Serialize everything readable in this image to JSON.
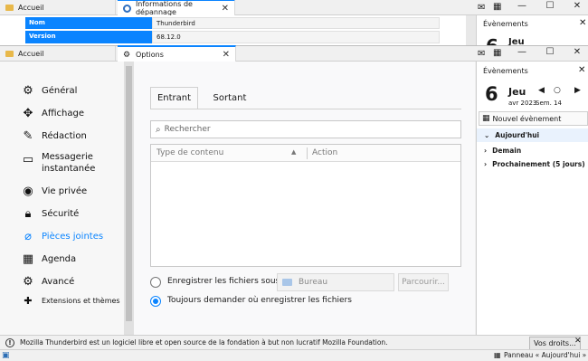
{
  "bg_window": {
    "tabs": [
      "Accueil",
      "Informations de dépannage"
    ],
    "table": {
      "rows": [
        [
          "Nom",
          "Thunderbird"
        ],
        [
          "Version",
          "68.12.0"
        ]
      ]
    },
    "events_title": "Évènements",
    "day_partial": "Jeu"
  },
  "window": {
    "tabs": [
      {
        "label": "Accueil"
      },
      {
        "label": "Options"
      }
    ],
    "close_glyph": "✕",
    "minimize_glyph": "—",
    "maximize_glyph": "☐"
  },
  "nav": {
    "items": [
      {
        "label": "Général",
        "icon": "gear-icon"
      },
      {
        "label": "Affichage",
        "icon": "display-icon"
      },
      {
        "label": "Rédaction",
        "icon": "pencil-icon"
      },
      {
        "label": "Messagerie instantanée",
        "icon": "chat-icon"
      },
      {
        "label": "Vie privée",
        "icon": "mask-icon"
      },
      {
        "label": "Sécurité",
        "icon": "lock-icon"
      },
      {
        "label": "Pièces jointes",
        "icon": "paperclip-icon"
      },
      {
        "label": "Agenda",
        "icon": "calendar-icon"
      },
      {
        "label": "Avancé",
        "icon": "gear-icon"
      },
      {
        "label": "Extensions et thèmes",
        "icon": "puzzle-icon"
      }
    ],
    "selected": "Pièces jointes"
  },
  "attachments": {
    "tabs": [
      "Entrant",
      "Sortant"
    ],
    "search_placeholder": "Rechercher",
    "columns": [
      "Type de contenu",
      "Action"
    ],
    "save_option": "Enregistrer les fichiers sous",
    "folder_value": "Bureau",
    "browse_label": "Parcourir...",
    "ask_option": "Toujours demander où enregistrer les fichiers"
  },
  "sidebar": {
    "title": "Évènements",
    "day_number": "6",
    "day_name": "Jeu",
    "month_year": "avr 2023",
    "week": "Sem. 14",
    "new_event": "Nouvel évènement",
    "groups": [
      "Aujourd'hui",
      "Demain",
      "Prochainement (5 jours)"
    ]
  },
  "statusbar": {
    "message": "Mozilla Thunderbird est un logiciel libre et open source de la fondation à but non lucratif Mozilla Foundation.",
    "rights_button": "Vos droits...",
    "panel_label": "Panneau « Aujourd'hui »"
  }
}
